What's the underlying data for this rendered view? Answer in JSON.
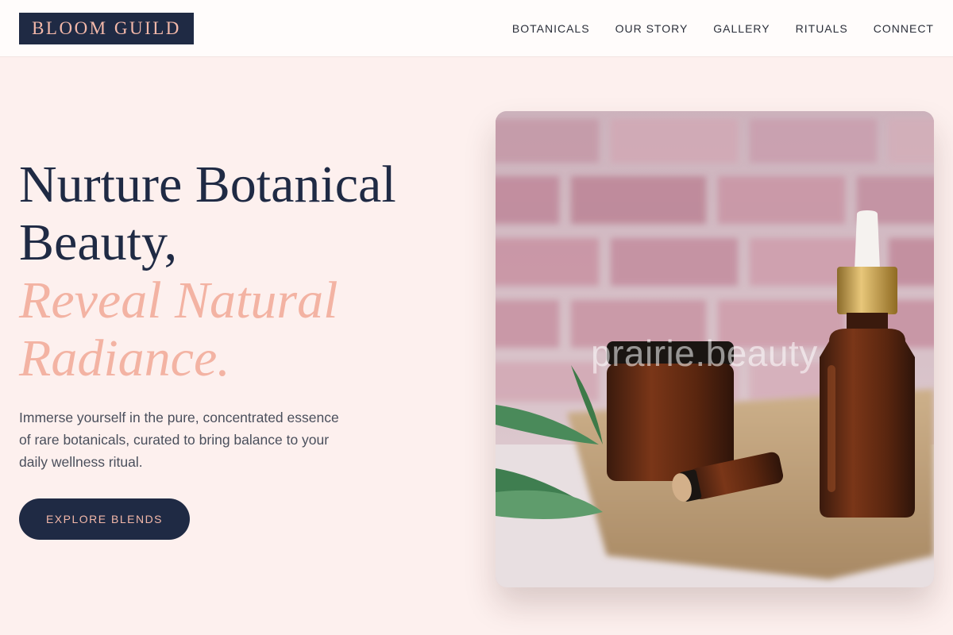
{
  "header": {
    "logo": "BLOOM GUILD",
    "nav": [
      "BOTANICALS",
      "OUR STORY",
      "GALLERY",
      "RITUALS",
      "CONNECT"
    ]
  },
  "hero": {
    "title_line1": "Nurture Botanical",
    "title_line2": "Beauty,",
    "accent_line1": "Reveal Natural",
    "accent_line2": "Radiance.",
    "description": "Immerse yourself in the pure, concentrated essence of rare botanicals, curated to bring balance to your daily wellness ritual.",
    "cta_label": "EXPLORE BLENDS",
    "image_watermark": "prairie.beauty"
  },
  "colors": {
    "background": "#fdf0ee",
    "navy": "#1f2a44",
    "accent_pink": "#f3b3a3"
  }
}
